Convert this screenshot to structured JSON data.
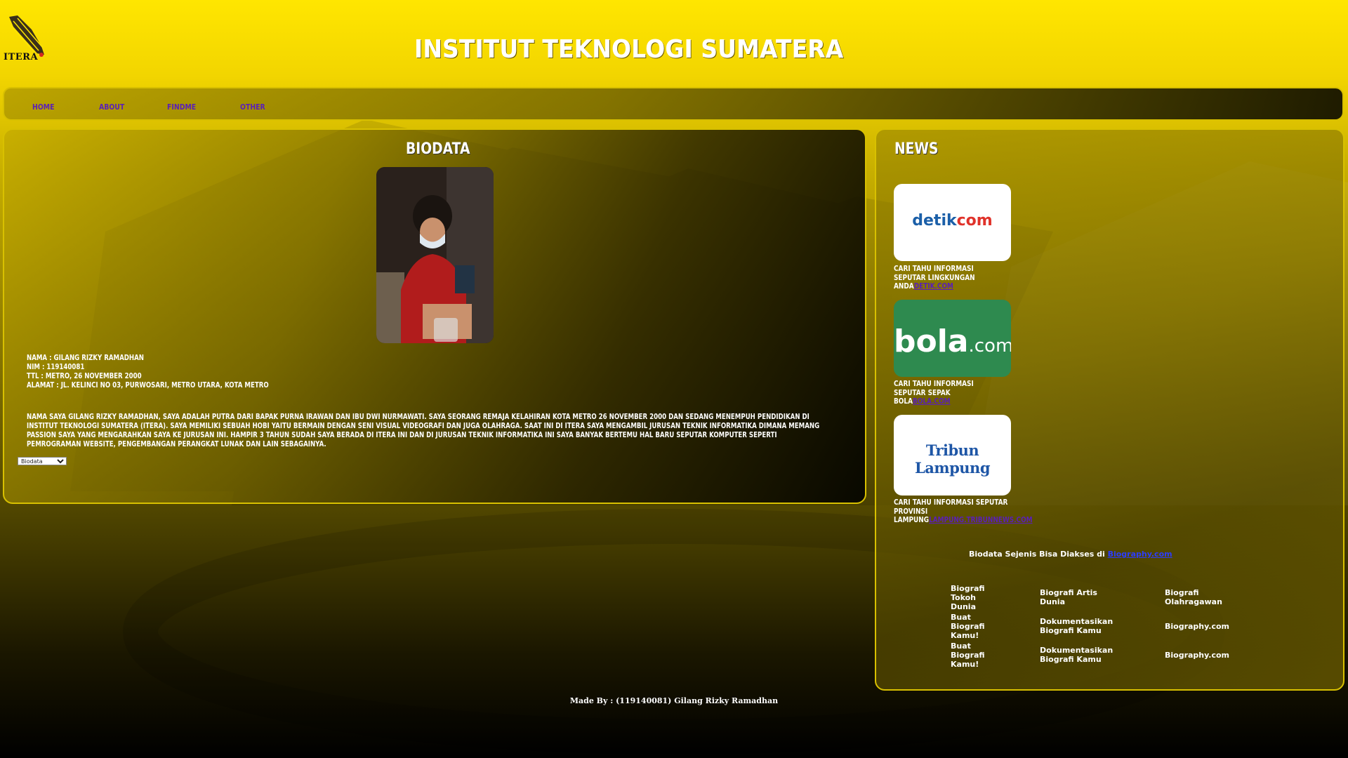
{
  "header": {
    "logo_text": "ITERA",
    "title": "INSTITUT TEKNOLOGI SUMATERA"
  },
  "nav": {
    "items": [
      {
        "label": "HOME"
      },
      {
        "label": "ABOUT"
      },
      {
        "label": "FINDME"
      },
      {
        "label": "OTHER"
      }
    ]
  },
  "biodata": {
    "heading": "BIODATA",
    "lines": [
      "NAMA : GILANG RIZKY RAMADHAN",
      "NIM : 119140081",
      "TTL : METRO, 26 NOVEMBER 2000",
      "ALAMAT : JL. KELINCI NO 03, PURWOSARI, METRO UTARA, KOTA METRO"
    ],
    "paragraph": "NAMA SAYA GILANG RIZKY RAMADHAN, SAYA ADALAH PUTRA DARI BAPAK PURNA IRAWAN DAN IBU DWI NURMAWATI. SAYA SEORANG REMAJA KELAHIRAN KOTA METRO 26 NOVEMBER 2000 DAN SEDANG MENEMPUH PENDIDIKAN DI INSTITUT TEKNOLOGI SUMATERA (ITERA). SAYA MEMILIKI SEBUAH HOBI YAITU BERMAIN DENGAN SENI VISUAL VIDEOGRAFI DAN JUGA OLAHRAGA. SAAT INI DI ITERA SAYA MENGAMBIL JURUSAN TEKNIK INFORMATIKA DIMANA MEMANG PASSION SAYA YANG MENGARAHKAN SAYA KE JURUSAN INI. HAMPIR 3 TAHUN SUDAH SAYA BERADA DI ITERA INI DAN DI JURUSAN TEKNIK INFORMATIKA INI SAYA BANYAK BERTEMU HAL BARU SEPUTAR KOMPUTER SEPERTI PEMROGRAMAN WEBSITE, PENGEMBANGAN PERANGKAT LUNAK DAN LAIN SEBAGAINYA.",
    "select_value": "Biodata"
  },
  "news": {
    "heading": "NEWS",
    "items": [
      {
        "logo_main": "detik",
        "logo_accent": "com",
        "caption": "CARI TAHU INFORMASI SEPUTAR LINGKUNGAN ANDA",
        "link": "DETIK.COM"
      },
      {
        "logo_main": "bola",
        "logo_accent": ".com",
        "caption": "CARI TAHU INFORMASI SEPUTAR SEPAK BOLA",
        "link": "BOLA.COM"
      },
      {
        "logo_main": "Tribun Lampung",
        "caption": "CARI TAHU INFORMASI SEPUTAR PROVINSI LAMPUNG",
        "link": "LAMPUNG.TRIBUNNEWS.COM"
      }
    ],
    "sejenis_text": "Biodata Sejenis Bisa Diakses di ",
    "sejenis_link": "Biography.com",
    "links": [
      [
        "Biografi Tokoh Dunia",
        "Biografi Artis Dunia",
        "Biografi Olahragawan"
      ],
      [
        "Buat Biografi Kamu!",
        "Dokumentasikan Biografi Kamu",
        "Biography.com"
      ],
      [
        "Buat Biografi Kamu!",
        "Dokumentasikan Biografi Kamu",
        "Biography.com"
      ]
    ]
  },
  "footer": {
    "text": "Made By : (119140081) Gilang Rizky Ramadhan"
  },
  "colors": {
    "accent": "#ffe600",
    "nav_link": "#5a1fb8",
    "detik_blue": "#1b5fa8",
    "detik_red": "#e0322a",
    "bola_green": "#2e8a4f",
    "tribun_blue": "#1e56a6"
  }
}
